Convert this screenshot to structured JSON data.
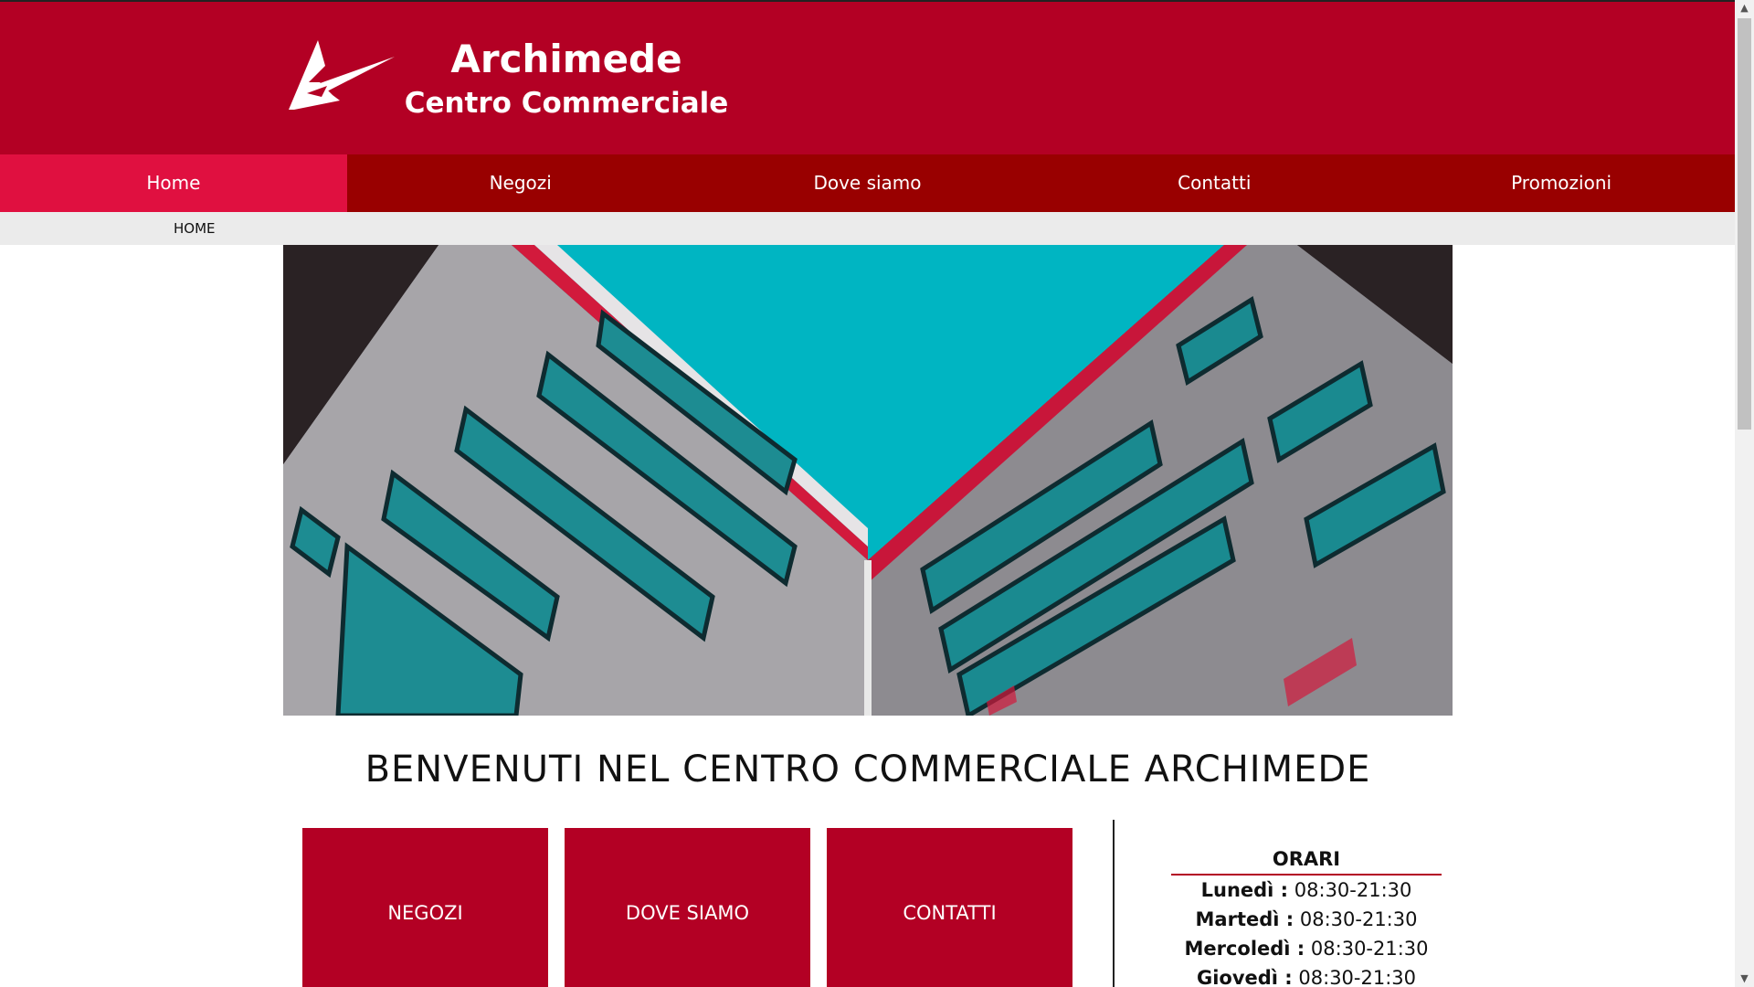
{
  "brand": {
    "title": "Archimede",
    "subtitle": "Centro Commerciale",
    "colors": {
      "primary": "#b30024",
      "nav": "#990000",
      "nav_active": "#e01040"
    }
  },
  "nav": {
    "items": [
      "Home",
      "Negozi",
      "Dove siamo",
      "Contatti",
      "Promozioni"
    ],
    "active": "Home"
  },
  "breadcrumb": {
    "current": "HOME"
  },
  "hero": {
    "image_icon": "building-courtyard-photo"
  },
  "main": {
    "welcome": "BENVENUTI NEL CENTRO COMMERCIALE ARCHIMEDE",
    "tiles": [
      "NEGOZI",
      "DOVE SIAMO",
      "CONTATTI"
    ]
  },
  "hours": {
    "title": "ORARI",
    "rows": [
      {
        "day": "Lunedì :",
        "time": "08:30-21:30"
      },
      {
        "day": "Martedì :",
        "time": "08:30-21:30"
      },
      {
        "day": "Mercoledì :",
        "time": "08:30-21:30"
      },
      {
        "day": "Giovedì :",
        "time": "08:30-21:30"
      }
    ]
  },
  "scrollbar": {
    "up_icon": "chevron-up-icon",
    "down_icon": "chevron-down-icon"
  }
}
